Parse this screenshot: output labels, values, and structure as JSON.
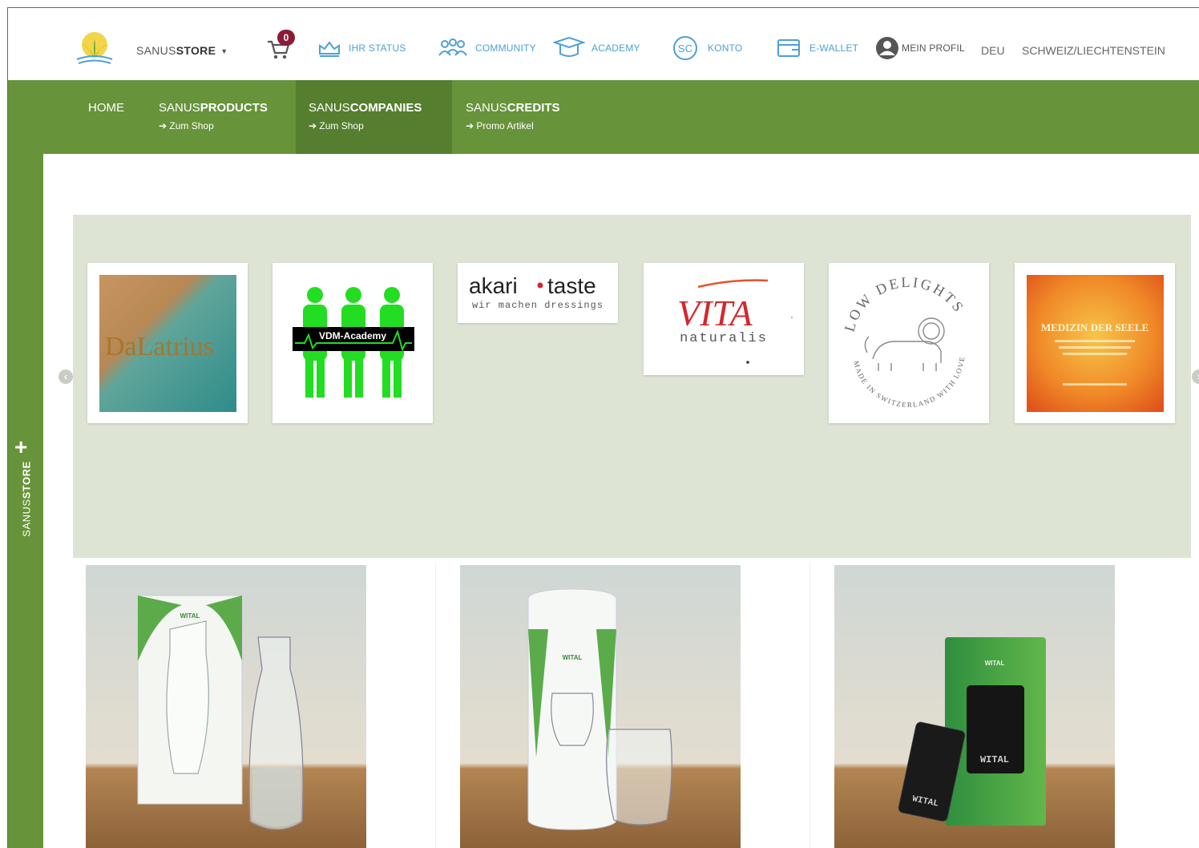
{
  "header": {
    "store_prefix": "SANUS",
    "store_bold": "STORE",
    "cart_count": "0",
    "nav": [
      {
        "label": "IHR STATUS",
        "icon": "crown-icon"
      },
      {
        "label": "COMMUNITY",
        "icon": "community-icon"
      },
      {
        "label": "ACADEMY",
        "icon": "graduation-cap-icon"
      },
      {
        "label": "KONTO",
        "icon": "sc-coin-icon"
      },
      {
        "label": "E-WALLET",
        "icon": "wallet-icon"
      },
      {
        "label": "MEIN PROFIL",
        "icon": "user-avatar-icon"
      }
    ],
    "language": "DEU",
    "region": "SCHWEIZ/LIECHTENSTEIN"
  },
  "subnav": {
    "home": "HOME",
    "items": [
      {
        "prefix": "SANUS",
        "bold": "PRODUCTS",
        "sub": "➔ Zum Shop"
      },
      {
        "prefix": "SANUS",
        "bold": "COMPANIES",
        "sub": "➔ Zum Shop"
      },
      {
        "prefix": "SANUS",
        "bold": "CREDITS",
        "sub": "➔ Promo Artikel"
      }
    ]
  },
  "sidebar": {
    "plus": "+",
    "prefix": "SANUS",
    "bold": "STORE"
  },
  "carousel": {
    "cards": [
      {
        "name": "Dalatrius",
        "text": "DaLatrius"
      },
      {
        "name": "VDM-Academy",
        "text": "VDM-Academy"
      },
      {
        "name": "akari taste",
        "brand_a": "akari",
        "brand_b": "taste",
        "tagline": "wir machen dressings"
      },
      {
        "name": "Vita naturalis",
        "brand_a": "VITA",
        "brand_b": "naturalis"
      },
      {
        "name": "Low Delights",
        "top": "LOW DELIGHTS",
        "bottom": "MADE IN SWITZERLAND WITH LOVE"
      },
      {
        "name": "Medizin der Seele",
        "text": "MEDIZIN DER SEELE"
      }
    ]
  },
  "products": [
    {
      "brand": "WITAL"
    },
    {
      "brand": "WITAL"
    },
    {
      "brand": "WITAL"
    }
  ],
  "colors": {
    "green": "#67933a",
    "green_dark": "#557e2e",
    "accent_blue": "#4ca0d8",
    "badge": "#8b1a35",
    "carousel_bg": "#dde4d3"
  }
}
